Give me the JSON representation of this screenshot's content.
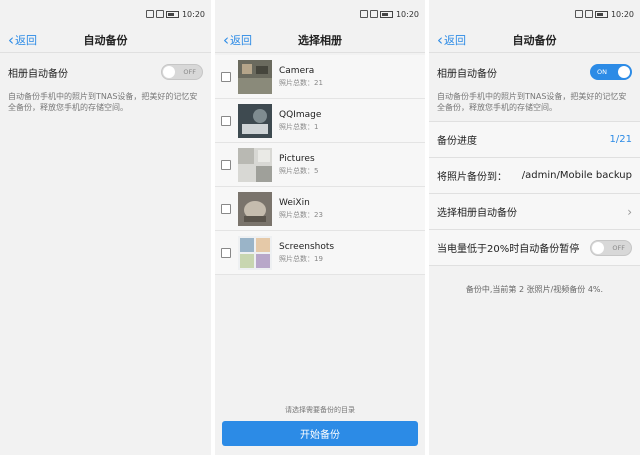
{
  "statusbar": {
    "time": "10:20"
  },
  "panel1": {
    "back_label": "返回",
    "title": "自动备份",
    "setting_label": "相册自动备份",
    "toggle_text": "OFF",
    "description": "自动备份手机中的照片到TNAS设备，把美好的记忆安全备份，释放您手机的存储空间。"
  },
  "panel2": {
    "back_label": "返回",
    "title": "选择相册",
    "albums": [
      {
        "name": "Camera",
        "count": "照片总数：21"
      },
      {
        "name": "QQImage",
        "count": "照片总数：1"
      },
      {
        "name": "Pictures",
        "count": "照片总数：5"
      },
      {
        "name": "WeiXin",
        "count": "照片总数：23"
      },
      {
        "name": "Screenshots",
        "count": "照片总数：19"
      }
    ],
    "hint": "请选择需要备份的目录",
    "start_button": "开始备份"
  },
  "panel3": {
    "back_label": "返回",
    "title": "自动备份",
    "setting_label": "相册自动备份",
    "toggle_text": "ON",
    "description": "自动备份手机中的照片到TNAS设备，把美好的记忆安全备份，释放您手机的存储空间。",
    "progress_label": "备份进度",
    "progress_value": "1/21",
    "backup_to_label": "将照片备份到：",
    "backup_to_value": "/admin/Mobile backup",
    "select_album_label": "选择相册自动备份",
    "battery_label": "当电量低于20%时自动备份暂停",
    "battery_toggle_text": "OFF",
    "status_message": "备份中,当前第 2 张照片/视频备份 4%."
  },
  "colors": {
    "accent": "#2c8be6",
    "background": "#f2f2f2"
  }
}
